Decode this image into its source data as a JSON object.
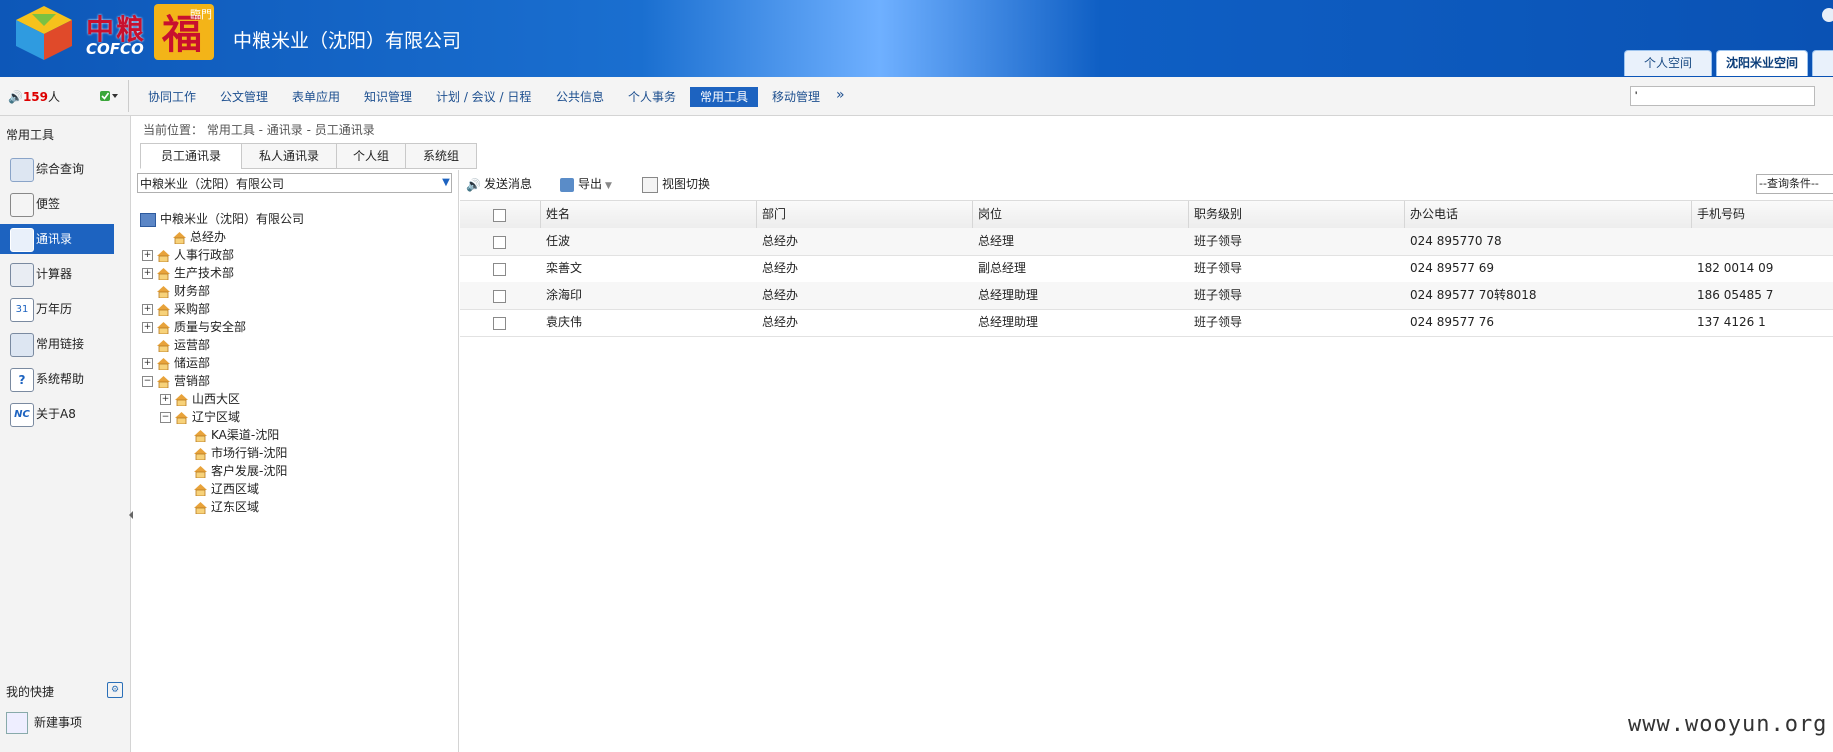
{
  "header": {
    "logo_cn": "中粮",
    "logo_en": "COFCO",
    "logo_fu_text": "臨門",
    "company": "中粮米业（沈阳）有限公司",
    "tabs": [
      "个人空间",
      "沈阳米业空间"
    ]
  },
  "navbar": {
    "online_count": "159",
    "online_unit": "人",
    "items": [
      "协同工作",
      "公文管理",
      "表单应用",
      "知识管理",
      "计划 / 会议 / 日程",
      "公共信息",
      "个人事务",
      "常用工具",
      "移动管理"
    ],
    "active_index": 7,
    "more": "»",
    "search_value": "'"
  },
  "sidebar": {
    "title": "常用工具",
    "items": [
      "综合查询",
      "便签",
      "通讯录",
      "计算器",
      "万年历",
      "常用链接",
      "系统帮助",
      "关于A8"
    ],
    "active_index": 2,
    "quick_title": "我的快捷",
    "quick_new": "新建事项"
  },
  "breadcrumb": "当前位置： 常用工具 - 通讯录 - 员工通讯录",
  "subtabs": [
    "员工通讯录",
    "私人通讯录",
    "个人组",
    "系统组"
  ],
  "org_select": "中粮米业（沈阳）有限公司",
  "tree": {
    "root": "中粮米业（沈阳）有限公司",
    "nodes": [
      "总经办",
      "人事行政部",
      "生产技术部",
      "财务部",
      "采购部",
      "质量与安全部",
      "运营部",
      "储运部",
      "营销部",
      "山西大区",
      "辽宁区域",
      "KA渠道-沈阳",
      "市场行销-沈阳",
      "客户发展-沈阳",
      "辽西区域",
      "辽东区域"
    ]
  },
  "toolbar": {
    "send": "发送消息",
    "export": "导出",
    "view": "视图切换",
    "query": "--查询条件--"
  },
  "grid": {
    "headers": [
      "姓名",
      "部门",
      "岗位",
      "职务级别",
      "办公电话",
      "手机号码"
    ],
    "rows": [
      [
        "任波",
        "总经办",
        "总经理",
        "班子领导",
        "024 895770 78",
        ""
      ],
      [
        "栾善文",
        "总经办",
        "副总经理",
        "班子领导",
        "024 89577 69",
        "182 0014 09"
      ],
      [
        "涂海印",
        "总经办",
        "总经理助理",
        "班子领导",
        "024 89577 70转8018",
        "186 05485 7"
      ],
      [
        "袁庆伟",
        "总经办",
        "总经理助理",
        "班子领导",
        "024 89577 76",
        "137 4126 1"
      ]
    ]
  },
  "watermark": "www.wooyun.org"
}
